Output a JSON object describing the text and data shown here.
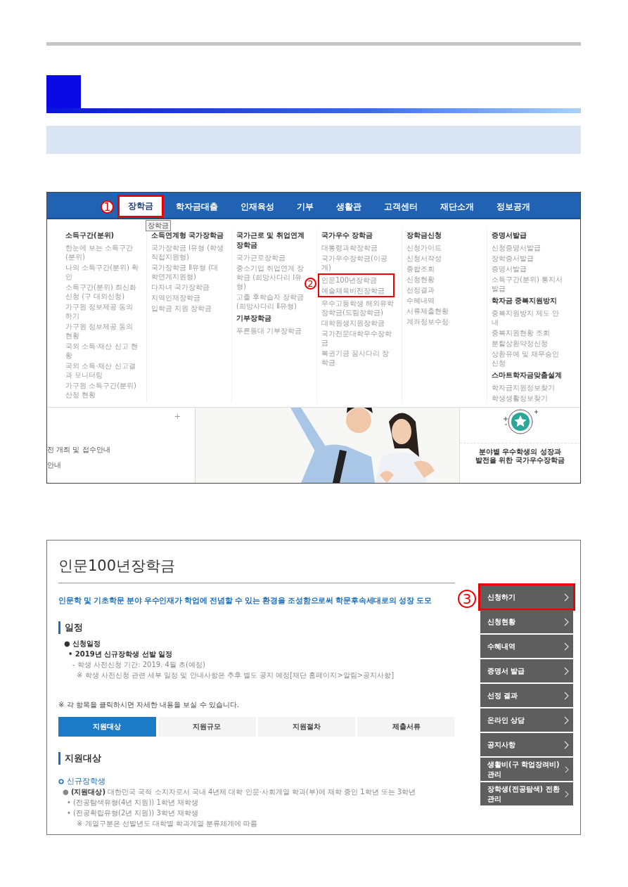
{
  "nav": {
    "items": [
      {
        "label": "장학금",
        "selected": true,
        "marked": true,
        "callout": "1",
        "tooltip": "장학금"
      },
      {
        "label": "학자금대출",
        "selected": false,
        "marked": false
      },
      {
        "label": "인재육성",
        "selected": false,
        "marked": false
      },
      {
        "label": "기부",
        "selected": false,
        "marked": false
      },
      {
        "label": "생활관",
        "selected": false,
        "marked": false
      },
      {
        "label": "고객센터",
        "selected": false,
        "marked": false
      },
      {
        "label": "재단소개",
        "selected": false,
        "marked": false
      },
      {
        "label": "정보공개",
        "selected": false,
        "marked": false
      }
    ]
  },
  "menu_columns": [
    {
      "groups": [
        {
          "heading": "소득구간(분위)",
          "items": [
            {
              "text": "한눈에 보는 소득구간(분위)",
              "marked": false
            },
            {
              "text": "나의 소득구간(분위) 확인",
              "marked": false
            },
            {
              "text": "소득구간(분위) 최신화 신청 (구 대외신청)",
              "marked": false
            },
            {
              "text": "가구원 정보제공 동의 하기",
              "marked": false
            },
            {
              "text": "가구원 정보제공 동의현황",
              "marked": false
            },
            {
              "text": "국외 소득·재산 신고 현황",
              "marked": false
            },
            {
              "text": "국외 소득·재산 신고결과 모니터링",
              "marked": false
            },
            {
              "text": "가구원 소득구간(분위) 산정 현황",
              "marked": false
            }
          ]
        }
      ]
    },
    {
      "groups": [
        {
          "heading": "소득연계형 국가장학금",
          "items": [
            {
              "text": "국가장학금 Ⅰ유형 (학생직접지원형)",
              "marked": false
            },
            {
              "text": "국가장학금 Ⅱ유형 (대학연계지원형)",
              "marked": false
            },
            {
              "text": "다자녀 국가장학금",
              "marked": false
            },
            {
              "text": "지역인재장학금",
              "marked": false
            },
            {
              "text": "입학금 지원 장학금",
              "marked": false
            }
          ]
        }
      ]
    },
    {
      "groups": [
        {
          "heading": "국가근로 및 취업연계 장학금",
          "items": [
            {
              "text": "국가근로장학금",
              "marked": false
            },
            {
              "text": "중소기업 취업연계 장학금 (희망사다리 Ⅰ유형)",
              "marked": false
            },
            {
              "text": "고졸 후학습자 장학금 (희망사다리 Ⅱ유형)",
              "marked": false
            }
          ]
        },
        {
          "heading": "기부장학금",
          "items": [
            {
              "text": "푸른등대 기부장학금",
              "marked": false
            }
          ]
        }
      ]
    },
    {
      "groups": [
        {
          "heading": "국가우수 장학금",
          "items": [
            {
              "text": "대통령과학장학금",
              "marked": false
            },
            {
              "text": "국가우수장학금(이공계)",
              "marked": false
            },
            {
              "text": "인문100년장학금",
              "marked": true,
              "callout": "2"
            },
            {
              "text": "예술체육비전장학금",
              "marked": true
            },
            {
              "text": "우수고등학생 해외유학 장학금(드림장학금)",
              "marked": false
            },
            {
              "text": "대학원생지원장학금",
              "marked": false
            },
            {
              "text": "국가전문대학우수장학금",
              "marked": false
            },
            {
              "text": "복권기금 꿈사다리 장학금",
              "marked": false
            }
          ]
        }
      ]
    },
    {
      "groups": [
        {
          "heading": "장학금신청",
          "items": [
            {
              "text": "신청가이드",
              "marked": false
            },
            {
              "text": "신청서작성",
              "marked": false
            },
            {
              "text": "종합조회",
              "marked": false
            },
            {
              "text": "신청현황",
              "marked": false
            },
            {
              "text": "선정결과",
              "marked": false
            },
            {
              "text": "수혜내역",
              "marked": false
            },
            {
              "text": "서류제출현황",
              "marked": false
            },
            {
              "text": "계좌정보수정",
              "marked": false
            }
          ]
        }
      ]
    },
    {
      "groups": [
        {
          "heading": "증명서발급",
          "items": [
            {
              "text": "신청증명서발급",
              "marked": false
            },
            {
              "text": "장학증서발급",
              "marked": false
            },
            {
              "text": "증명서발급",
              "marked": false
            },
            {
              "text": "소득구간(분위) 통지서 발급",
              "marked": false
            }
          ]
        },
        {
          "heading": "학자금 중복지원방지",
          "items": [
            {
              "text": "중복지원방지 제도 안내",
              "marked": false
            },
            {
              "text": "중복지원현황 조회",
              "marked": false
            },
            {
              "text": "분할상환약정신청",
              "marked": false
            },
            {
              "text": "상환유예 및 채무승인 신청",
              "marked": false
            }
          ]
        },
        {
          "heading": "스마트학자금맞춤설계",
          "items": [
            {
              "text": "학자금지원정보찾기",
              "marked": false
            },
            {
              "text": "학생생활정보찾기",
              "marked": false
            }
          ]
        }
      ]
    }
  ],
  "lower_strip": {
    "expand": "+",
    "notices": [
      "전 개최 및 접수안내",
      "안내"
    ],
    "promo": "분야별 우수학생의 성장과\n발전을 위한 국가우수장학금"
  },
  "page": {
    "title": "인문100년장학금",
    "lead": "인문학 및 기초학문 분야 우수인재가 학업에 전념할 수 있는 환경을 조성함으로써 학문후속세대로의 성장 도모",
    "schedule": {
      "heading": "일정",
      "lines": [
        {
          "kind": "title",
          "text": "● 신청일정"
        },
        {
          "kind": "subtitle",
          "text": "• 2019년 신규장학생 선발 일정"
        },
        {
          "kind": "detail",
          "text": "- 학생 사전신청 기간: 2019. 4월 초(예정)"
        },
        {
          "kind": "note",
          "text": "※ 학생 사전신청 관련 세부 일정 및 안내사항은 추후 별도 공지 예정[재단 홈페이지>알림>공지사항]"
        }
      ]
    },
    "hint": "※ 각 항목을 클릭하시면 자세한 내용을 보실 수 있습니다.",
    "tabs": [
      {
        "label": "지원대상",
        "selected": true
      },
      {
        "label": "지원규모",
        "selected": false
      },
      {
        "label": "지원절차",
        "selected": false
      },
      {
        "label": "제출서류",
        "selected": false
      }
    ],
    "targets": {
      "heading": "지원대상",
      "subheading": "신규장학생",
      "lines": [
        {
          "kind": "main",
          "text": "● **(지원대상)** 대한민국 국적 소지자로서 국내 4년제 대학 인문·사회계열 학과(부)에 재학 중인 1학년 또는 3학년"
        },
        {
          "kind": "sub",
          "text": "• (전공탐색유형(4년 지원)) 1학년 재학생"
        },
        {
          "kind": "sub",
          "text": "• (전공확립유형(2년 지원)) 3학년 재학생"
        },
        {
          "kind": "note",
          "text": "※ 계열구분은 선발년도 대학별 학과계열 분류체계에 따름"
        }
      ]
    },
    "side_menu": [
      {
        "label": "신청하기",
        "marked": true,
        "callout": "3"
      },
      {
        "label": "신청현황",
        "marked": false
      },
      {
        "label": "수혜내역",
        "marked": false
      },
      {
        "label": "증명서 발급",
        "marked": false
      },
      {
        "label": "선정 결과",
        "marked": false
      },
      {
        "label": "온라인 상담",
        "marked": false
      },
      {
        "label": "공지사항",
        "marked": false
      },
      {
        "label": "생활비(구 학업장려비) 관리",
        "marked": false
      },
      {
        "label": "장학생(전공탐색) 전환 관리",
        "marked": false
      }
    ]
  }
}
